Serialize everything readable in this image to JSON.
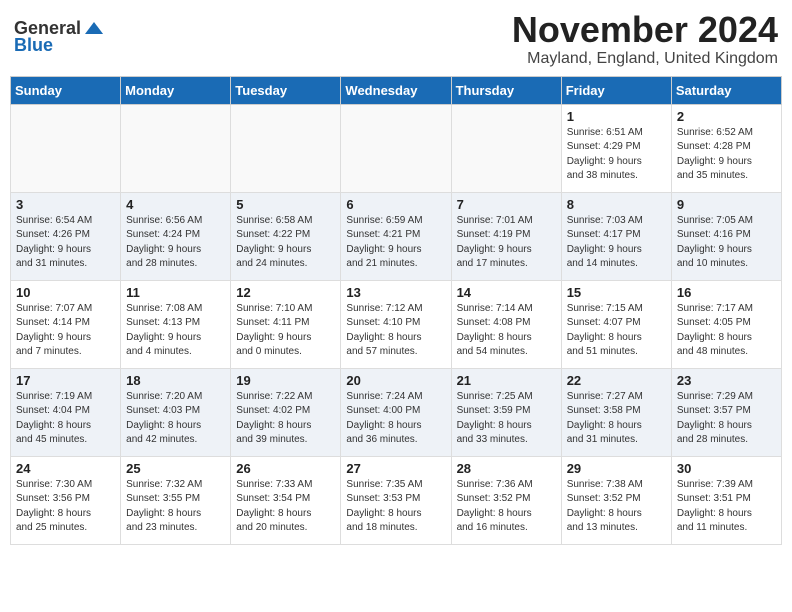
{
  "logo": {
    "general": "General",
    "blue": "Blue"
  },
  "title": "November 2024",
  "location": "Mayland, England, United Kingdom",
  "days_of_week": [
    "Sunday",
    "Monday",
    "Tuesday",
    "Wednesday",
    "Thursday",
    "Friday",
    "Saturday"
  ],
  "weeks": [
    [
      {
        "day": "",
        "info": ""
      },
      {
        "day": "",
        "info": ""
      },
      {
        "day": "",
        "info": ""
      },
      {
        "day": "",
        "info": ""
      },
      {
        "day": "",
        "info": ""
      },
      {
        "day": "1",
        "info": "Sunrise: 6:51 AM\nSunset: 4:29 PM\nDaylight: 9 hours\nand 38 minutes."
      },
      {
        "day": "2",
        "info": "Sunrise: 6:52 AM\nSunset: 4:28 PM\nDaylight: 9 hours\nand 35 minutes."
      }
    ],
    [
      {
        "day": "3",
        "info": "Sunrise: 6:54 AM\nSunset: 4:26 PM\nDaylight: 9 hours\nand 31 minutes."
      },
      {
        "day": "4",
        "info": "Sunrise: 6:56 AM\nSunset: 4:24 PM\nDaylight: 9 hours\nand 28 minutes."
      },
      {
        "day": "5",
        "info": "Sunrise: 6:58 AM\nSunset: 4:22 PM\nDaylight: 9 hours\nand 24 minutes."
      },
      {
        "day": "6",
        "info": "Sunrise: 6:59 AM\nSunset: 4:21 PM\nDaylight: 9 hours\nand 21 minutes."
      },
      {
        "day": "7",
        "info": "Sunrise: 7:01 AM\nSunset: 4:19 PM\nDaylight: 9 hours\nand 17 minutes."
      },
      {
        "day": "8",
        "info": "Sunrise: 7:03 AM\nSunset: 4:17 PM\nDaylight: 9 hours\nand 14 minutes."
      },
      {
        "day": "9",
        "info": "Sunrise: 7:05 AM\nSunset: 4:16 PM\nDaylight: 9 hours\nand 10 minutes."
      }
    ],
    [
      {
        "day": "10",
        "info": "Sunrise: 7:07 AM\nSunset: 4:14 PM\nDaylight: 9 hours\nand 7 minutes."
      },
      {
        "day": "11",
        "info": "Sunrise: 7:08 AM\nSunset: 4:13 PM\nDaylight: 9 hours\nand 4 minutes."
      },
      {
        "day": "12",
        "info": "Sunrise: 7:10 AM\nSunset: 4:11 PM\nDaylight: 9 hours\nand 0 minutes."
      },
      {
        "day": "13",
        "info": "Sunrise: 7:12 AM\nSunset: 4:10 PM\nDaylight: 8 hours\nand 57 minutes."
      },
      {
        "day": "14",
        "info": "Sunrise: 7:14 AM\nSunset: 4:08 PM\nDaylight: 8 hours\nand 54 minutes."
      },
      {
        "day": "15",
        "info": "Sunrise: 7:15 AM\nSunset: 4:07 PM\nDaylight: 8 hours\nand 51 minutes."
      },
      {
        "day": "16",
        "info": "Sunrise: 7:17 AM\nSunset: 4:05 PM\nDaylight: 8 hours\nand 48 minutes."
      }
    ],
    [
      {
        "day": "17",
        "info": "Sunrise: 7:19 AM\nSunset: 4:04 PM\nDaylight: 8 hours\nand 45 minutes."
      },
      {
        "day": "18",
        "info": "Sunrise: 7:20 AM\nSunset: 4:03 PM\nDaylight: 8 hours\nand 42 minutes."
      },
      {
        "day": "19",
        "info": "Sunrise: 7:22 AM\nSunset: 4:02 PM\nDaylight: 8 hours\nand 39 minutes."
      },
      {
        "day": "20",
        "info": "Sunrise: 7:24 AM\nSunset: 4:00 PM\nDaylight: 8 hours\nand 36 minutes."
      },
      {
        "day": "21",
        "info": "Sunrise: 7:25 AM\nSunset: 3:59 PM\nDaylight: 8 hours\nand 33 minutes."
      },
      {
        "day": "22",
        "info": "Sunrise: 7:27 AM\nSunset: 3:58 PM\nDaylight: 8 hours\nand 31 minutes."
      },
      {
        "day": "23",
        "info": "Sunrise: 7:29 AM\nSunset: 3:57 PM\nDaylight: 8 hours\nand 28 minutes."
      }
    ],
    [
      {
        "day": "24",
        "info": "Sunrise: 7:30 AM\nSunset: 3:56 PM\nDaylight: 8 hours\nand 25 minutes."
      },
      {
        "day": "25",
        "info": "Sunrise: 7:32 AM\nSunset: 3:55 PM\nDaylight: 8 hours\nand 23 minutes."
      },
      {
        "day": "26",
        "info": "Sunrise: 7:33 AM\nSunset: 3:54 PM\nDaylight: 8 hours\nand 20 minutes."
      },
      {
        "day": "27",
        "info": "Sunrise: 7:35 AM\nSunset: 3:53 PM\nDaylight: 8 hours\nand 18 minutes."
      },
      {
        "day": "28",
        "info": "Sunrise: 7:36 AM\nSunset: 3:52 PM\nDaylight: 8 hours\nand 16 minutes."
      },
      {
        "day": "29",
        "info": "Sunrise: 7:38 AM\nSunset: 3:52 PM\nDaylight: 8 hours\nand 13 minutes."
      },
      {
        "day": "30",
        "info": "Sunrise: 7:39 AM\nSunset: 3:51 PM\nDaylight: 8 hours\nand 11 minutes."
      }
    ]
  ]
}
